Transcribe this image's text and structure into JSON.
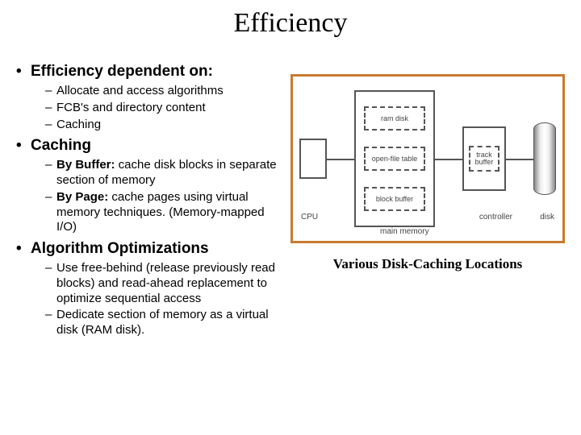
{
  "title": "Efficiency",
  "bullets": [
    {
      "header": "Efficiency dependent on:",
      "sub": [
        {
          "text": "Allocate and  access algorithms"
        },
        {
          "text": "FCB's and directory content"
        },
        {
          "text": "Caching"
        }
      ]
    },
    {
      "header": "Caching",
      "sub": [
        {
          "bold": "By Buffer:",
          "rest": " cache disk blocks in separate section of memory"
        },
        {
          "bold": "By Page:",
          "rest": " cache pages using virtual memory techniques. (Memory-mapped I/O)"
        }
      ]
    },
    {
      "header": "Algorithm Optimizations",
      "sub": [
        {
          "text": "Use free-behind (release previously read blocks) and read-ahead replacement to optimize sequential access"
        },
        {
          "text": "Dedicate section of memory as a virtual disk (RAM disk)."
        }
      ]
    }
  ],
  "diagram": {
    "cpu": "CPU",
    "mm_label": "main memory",
    "mm_boxes": [
      "ram disk",
      "open-file table",
      "block buffer"
    ],
    "ctrl_label": "controller",
    "ctrl_box": "track buffer",
    "disk_label": "disk"
  },
  "caption": "Various Disk-Caching Locations"
}
